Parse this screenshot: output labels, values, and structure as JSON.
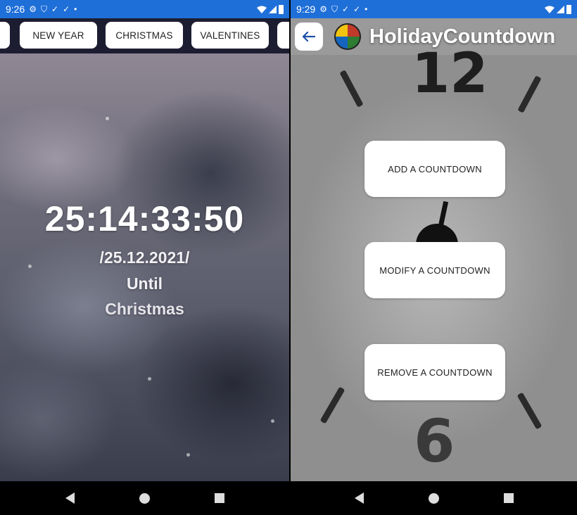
{
  "left_screen": {
    "status_bar": {
      "time": "9:26",
      "icons": [
        "gear-icon",
        "shield-icon",
        "check-download-icon",
        "check-download-icon",
        "dot-icon"
      ]
    },
    "tabs": [
      {
        "label": ""
      },
      {
        "label": "NEW YEAR"
      },
      {
        "label": "CHRISTMAS"
      },
      {
        "label": "VALENTINES"
      },
      {
        "label": ""
      }
    ],
    "countdown": {
      "timer": "25:14:33:50",
      "date": "/25.12.2021/",
      "until_label": "Until",
      "holiday_name": "Christmas"
    }
  },
  "right_screen": {
    "status_bar": {
      "time": "9:29",
      "icons": [
        "gear-icon",
        "shield-icon",
        "check-download-icon",
        "check-download-icon",
        "dot-icon"
      ]
    },
    "app_bar": {
      "title": "HolidayCountdown"
    },
    "actions": {
      "add_label": "ADD A COUNTDOWN",
      "modify_label": "MODIFY A COUNTDOWN",
      "remove_label": "REMOVE A COUNTDOWN"
    },
    "clock_numerals": {
      "top": "12",
      "bottom": "6"
    }
  },
  "colors": {
    "status_bar": "#1f6fd8",
    "tab_strip": "#1d1d32",
    "nav_bar": "#000000",
    "button_bg": "#ffffff"
  }
}
